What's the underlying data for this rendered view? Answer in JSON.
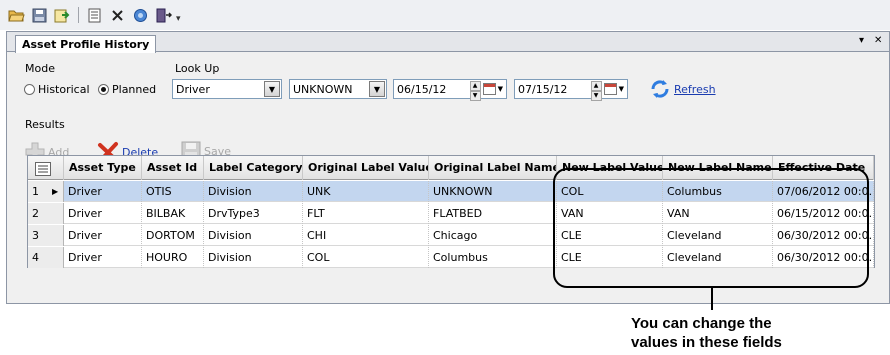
{
  "toolbar": {
    "icons": [
      "open-folder-icon",
      "save-icon",
      "export-icon",
      "list-icon",
      "close-x-icon",
      "globe-icon",
      "exit-door-icon"
    ]
  },
  "window": {
    "tab_title": "Asset Profile History",
    "pin_glyph": "▾",
    "close_glyph": "✕"
  },
  "form": {
    "mode_label": "Mode",
    "mode_options": [
      "Historical",
      "Planned"
    ],
    "mode_selected": "Planned",
    "lookup_label": "Look Up",
    "lookup_value": "Driver",
    "lookup_secondary_value": "UNKNOWN",
    "date_from": "06/15/12",
    "date_to": "07/15/12",
    "refresh_label": "Refresh"
  },
  "results": {
    "label": "Results",
    "add_label": "Add",
    "delete_label": "Delete",
    "save_label": "Save"
  },
  "grid": {
    "columns": [
      "Asset Type",
      "Asset Id",
      "Label Category",
      "Original Label Value",
      "Original Label Name",
      "New Label Value",
      "New Label Name",
      "Effective Date"
    ],
    "rows": [
      {
        "num": "1",
        "asset_type": "Driver",
        "asset_id": "OTIS",
        "label_category": "Division",
        "orig_value": "UNK",
        "orig_name": "UNKNOWN",
        "new_value": "COL",
        "new_name": "Columbus",
        "effective": "07/06/2012  00:0..."
      },
      {
        "num": "2",
        "asset_type": "Driver",
        "asset_id": "BILBAK",
        "label_category": "DrvType3",
        "orig_value": "FLT",
        "orig_name": "FLATBED",
        "new_value": "VAN",
        "new_name": "VAN",
        "effective": "06/15/2012  00:0..."
      },
      {
        "num": "3",
        "asset_type": "Driver",
        "asset_id": "DORTOM",
        "label_category": "Division",
        "orig_value": "CHI",
        "orig_name": "Chicago",
        "new_value": "CLE",
        "new_name": "Cleveland",
        "effective": "06/30/2012  00:0..."
      },
      {
        "num": "4",
        "asset_type": "Driver",
        "asset_id": "HOURO",
        "label_category": "Division",
        "orig_value": "COL",
        "orig_name": "Columbus",
        "new_value": "CLE",
        "new_name": "Cleveland",
        "effective": "06/30/2012  00:0..."
      }
    ]
  },
  "callout": {
    "text_line1": "You can change the",
    "text_line2": "values in these fields"
  },
  "colors": {
    "selected_row": "#c3d6ef",
    "link": "#1a3cb0",
    "delete_red": "#d0331f"
  }
}
